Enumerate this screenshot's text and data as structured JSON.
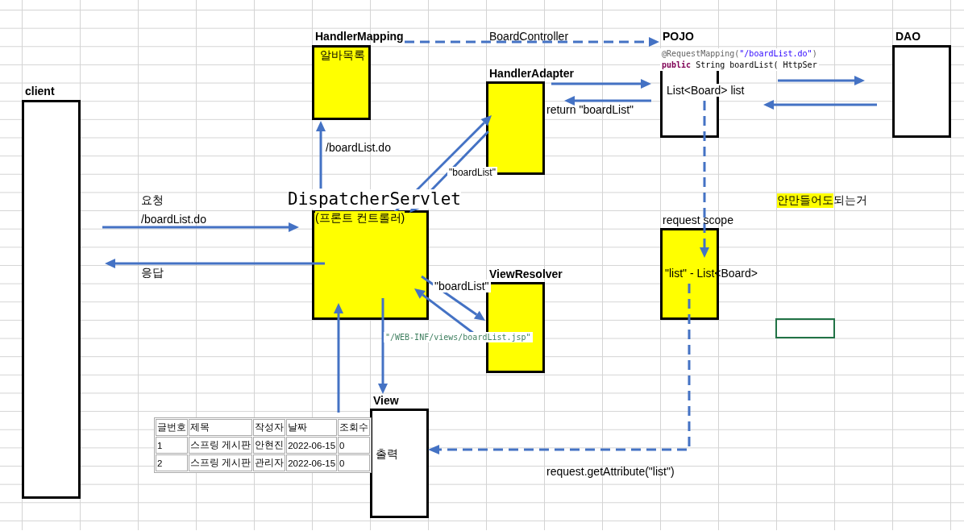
{
  "sheet": {
    "shapes": [
      {
        "kind": "bold",
        "label": "client",
        "highlighted": false
      },
      {
        "kind": "bold",
        "label": "HandlerMapping",
        "text": "알바목록",
        "highlighted": true
      },
      {
        "kind": "bold",
        "label": "POJO",
        "highlighted": false
      },
      {
        "kind": "bold",
        "label": "DAO",
        "highlighted": false
      },
      {
        "kind": "bold",
        "label": "HandlerAdapter",
        "highlighted": true
      },
      {
        "kind": "mono",
        "label": "DispatcherServlet",
        "text": "(프론트 컨트롤러)",
        "highlighted": true
      },
      {
        "kind": "bold",
        "label": "ViewResolver",
        "highlighted": true
      },
      {
        "kind": "plain",
        "label": "request scope",
        "highlighted": true
      },
      {
        "kind": "bold",
        "label": "View",
        "text": "출력",
        "highlighted": false
      }
    ],
    "code_lines": [
      [
        {
          "text": "@RequestMapping(",
          "kind": "annotation"
        },
        {
          "text": "\"/boardList.do\"",
          "kind": "string"
        },
        {
          "text": ")",
          "kind": "annotation"
        }
      ],
      [
        {
          "text": "public",
          "kind": "keyword"
        },
        {
          "text": " String boardList( HttpSer",
          "kind": "plain"
        }
      ]
    ],
    "notes": [
      {
        "kind": "plain",
        "text": "BoardController"
      },
      {
        "kind": "boxed",
        "text": "List<Board>  list"
      },
      {
        "kind": "plain",
        "text": "return \"boardList\""
      },
      {
        "kind": "plain",
        "text": "/boardList.do"
      },
      {
        "kind": "boxed",
        "text": "\"boardList\""
      },
      {
        "kind": "plain",
        "text": "요청"
      },
      {
        "kind": "plain",
        "text": "/boardList.do"
      },
      {
        "kind": "plain",
        "text": "응답"
      },
      {
        "kind": "boxed",
        "text": "\"boardList\""
      },
      {
        "kind": "path",
        "text": "\"/WEB-INF/views/boardList.jsp\""
      },
      {
        "kind": "plain",
        "text": "\"list\" - List<Board>"
      },
      {
        "kind": "highlight",
        "text": "안만들어도"
      },
      {
        "kind": "plain",
        "text": "되는거"
      },
      {
        "kind": "plain",
        "text": "request.getAttribute(\"list\")"
      }
    ],
    "table": {
      "columns": [
        "글번호",
        "제목",
        "작성자",
        "날짜",
        "조회수"
      ],
      "rows": [
        [
          "1",
          "스프링 게시판",
          "안현진",
          "2022-06-15",
          "0"
        ],
        [
          "2",
          "스프링 게시판",
          "관리자",
          "2022-06-15",
          "0"
        ]
      ]
    }
  }
}
